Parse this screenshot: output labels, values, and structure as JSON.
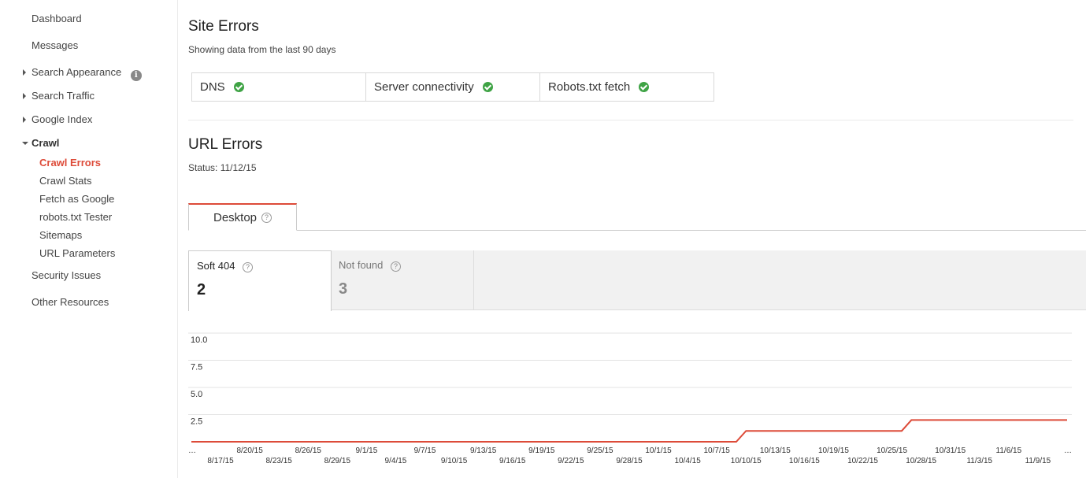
{
  "sidebar": {
    "items": [
      {
        "label": "Dashboard"
      },
      {
        "label": "Messages"
      },
      {
        "label": "Search Appearance",
        "info": "i"
      },
      {
        "label": "Search Traffic"
      },
      {
        "label": "Google Index"
      },
      {
        "label": "Crawl"
      },
      {
        "label": "Security Issues"
      },
      {
        "label": "Other Resources"
      }
    ],
    "crawl_sub": [
      {
        "label": "Crawl Errors"
      },
      {
        "label": "Crawl Stats"
      },
      {
        "label": "Fetch as Google"
      },
      {
        "label": "robots.txt Tester"
      },
      {
        "label": "Sitemaps"
      },
      {
        "label": "URL Parameters"
      }
    ]
  },
  "site_errors": {
    "title": "Site Errors",
    "subtitle": "Showing data from the last 90 days",
    "checks": [
      {
        "label": "DNS",
        "status": "ok"
      },
      {
        "label": "Server connectivity",
        "status": "ok"
      },
      {
        "label": "Robots.txt fetch",
        "status": "ok"
      }
    ]
  },
  "url_errors": {
    "title": "URL Errors",
    "status": "Status: 11/12/15",
    "tab": "Desktop",
    "help_glyph": "?",
    "metrics": [
      {
        "label": "Soft 404",
        "value": "2"
      },
      {
        "label": "Not found",
        "value": "3"
      }
    ]
  },
  "colors": {
    "accent": "#dd4b39",
    "ok": "#3fa345"
  },
  "chart_data": {
    "type": "line",
    "ylim": [
      0,
      10
    ],
    "yticks": [
      "10.0",
      "7.5",
      "5.0",
      "2.5"
    ],
    "xticks_upper": [
      "…",
      "8/20/15",
      "8/26/15",
      "9/1/15",
      "9/7/15",
      "9/13/15",
      "9/19/15",
      "9/25/15",
      "10/1/15",
      "10/7/15",
      "10/13/15",
      "10/19/15",
      "10/25/15",
      "10/31/15",
      "11/6/15",
      "…"
    ],
    "xticks_lower": [
      "8/17/15",
      "8/23/15",
      "8/29/15",
      "9/4/15",
      "9/10/15",
      "9/16/15",
      "9/22/15",
      "9/28/15",
      "10/4/15",
      "10/10/15",
      "10/16/15",
      "10/22/15",
      "10/28/15",
      "11/3/15",
      "11/9/15"
    ],
    "series": [
      {
        "color": "#dd4b39",
        "points": [
          [
            "8/14/15",
            0
          ],
          [
            "10/9/15",
            0
          ],
          [
            "10/10/15",
            1
          ],
          [
            "10/26/15",
            1
          ],
          [
            "10/27/15",
            2
          ],
          [
            "11/12/15",
            2
          ]
        ]
      }
    ]
  }
}
